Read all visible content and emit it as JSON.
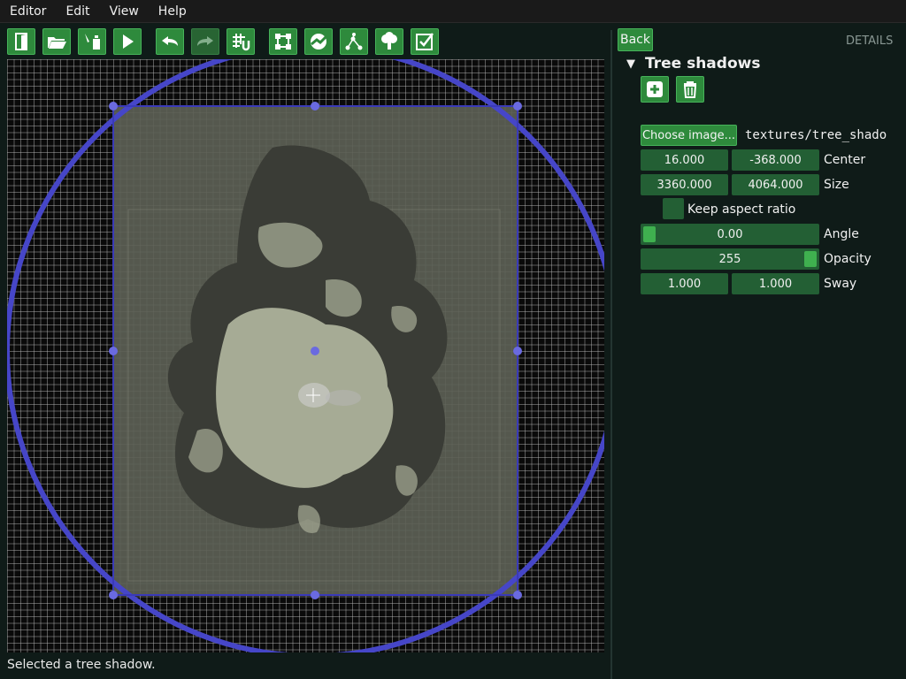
{
  "menu": [
    "Editor",
    "Edit",
    "View",
    "Help"
  ],
  "toolbar": {
    "buttons": [
      {
        "icon": "exit-door-icon",
        "enabled": true
      },
      {
        "icon": "open-folder-icon",
        "enabled": true
      },
      {
        "icon": "save-icon",
        "enabled": true
      },
      {
        "icon": "play-icon",
        "enabled": true
      },
      {
        "icon": "undo-icon",
        "enabled": true
      },
      {
        "icon": "redo-icon",
        "enabled": false
      },
      {
        "icon": "grid-snap-icon",
        "enabled": true
      },
      {
        "icon": "select-area-icon",
        "enabled": true
      },
      {
        "icon": "terrain-icon",
        "enabled": true
      },
      {
        "icon": "path-nodes-icon",
        "enabled": true
      },
      {
        "icon": "tree-icon",
        "enabled": true
      },
      {
        "icon": "checklist-icon",
        "enabled": true
      }
    ]
  },
  "panel": {
    "back_label": "Back",
    "details_label": "DETAILS",
    "section_title": "Tree shadows",
    "choose_image_label": "Choose image...",
    "image_path": "textures/tree_shado",
    "center": {
      "x": "16.000",
      "y": "-368.000",
      "label": "Center"
    },
    "size": {
      "w": "3360.000",
      "h": "4064.000",
      "label": "Size"
    },
    "keep_aspect_label": "Keep aspect ratio",
    "keep_aspect_checked": false,
    "angle": {
      "value": "0.00",
      "label": "Angle",
      "fraction": 0.0
    },
    "opacity": {
      "value": "255",
      "label": "Opacity",
      "fraction": 1.0
    },
    "sway": {
      "x": "1.000",
      "y": "1.000",
      "label": "Sway"
    }
  },
  "status": "Selected a tree shadow.",
  "colors": {
    "accent_green": "#2e8a3c",
    "field_green": "#235f34",
    "selection_blue": "#4040c0",
    "handle_blue": "#6a6ae0"
  }
}
